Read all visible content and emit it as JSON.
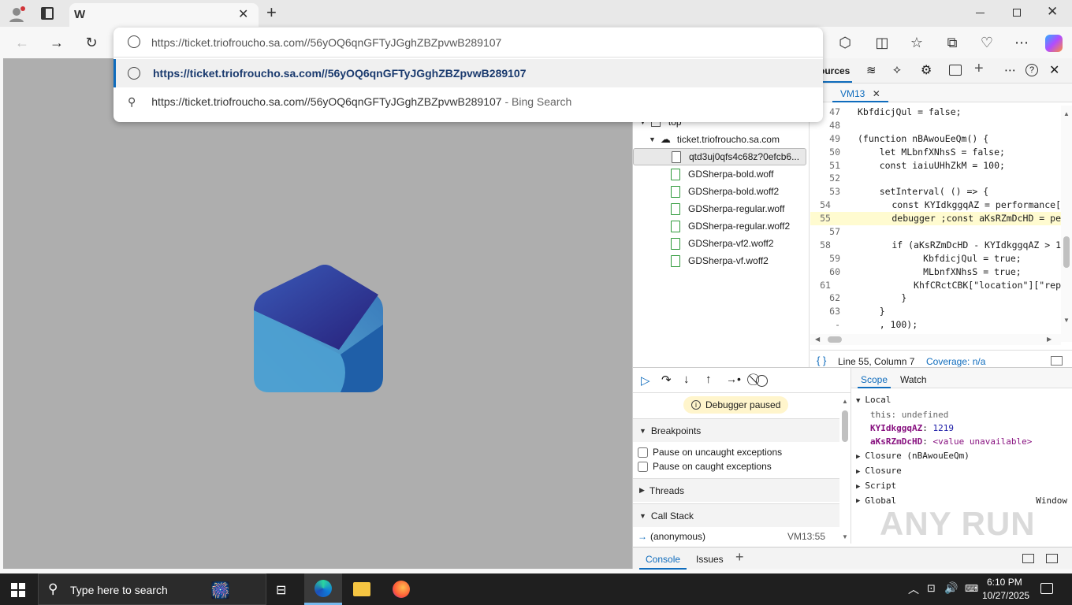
{
  "browser": {
    "tab_title_icon": "W",
    "url": "https://ticket.triofroucho.sa.com//56yOQ6qnGFTyJGghZBZpvwB289107",
    "suggestion_url": "https://ticket.triofroucho.sa.com//56yOQ6qnGFTyJGghZBZpvwB289107",
    "suggestion_search": "https://ticket.triofroucho.sa.com//56yOQ6qnGFTyJGghZBZpvwB289107",
    "suggestion_search_suffix": " - Bing Search"
  },
  "devtools": {
    "sources_tab": "ources",
    "file_tab": "VM13",
    "tree": {
      "top": "top",
      "domain": "ticket.triofroucho.sa.com",
      "files": [
        "qtd3uj0qfs4c68z?0efcb6...",
        "GDSherpa-bold.woff",
        "GDSherpa-bold.woff2",
        "GDSherpa-regular.woff",
        "GDSherpa-regular.woff2",
        "GDSherpa-vf2.woff2",
        "GDSherpa-vf.woff2"
      ]
    },
    "code_lines": [
      {
        "n": "47",
        "t": "KbfdicjQul = false;"
      },
      {
        "n": "48",
        "t": ""
      },
      {
        "n": "49",
        "t": "(function nBAwouEeQm() {"
      },
      {
        "n": "50",
        "t": "    let MLbnfXNhsS = false;"
      },
      {
        "n": "51",
        "t": "    const iaiuUHhZkM = 100;"
      },
      {
        "n": "52",
        "t": ""
      },
      {
        "n": "53",
        "t": "    setInterval( () => {"
      },
      {
        "n": "54",
        "t": "        const KYIdkggqAZ = performance["
      },
      {
        "n": "55",
        "t": "        debugger ;const aKsRZmDcHD = pe"
      },
      {
        "n": "57",
        "t": ""
      },
      {
        "n": "58",
        "t": "        if (aKsRZmDcHD - KYIdkggqAZ > 1"
      },
      {
        "n": "59",
        "t": "            KbfdicjQul = true;"
      },
      {
        "n": "60",
        "t": "            MLbnfXNhsS = true;"
      },
      {
        "n": "61",
        "t": "            KhfCRctCBK[\"location\"][\"rep"
      },
      {
        "n": "62",
        "t": "        }"
      },
      {
        "n": "63",
        "t": "    }"
      },
      {
        "n": "-",
        "t": "    , 100);"
      }
    ],
    "status_pos": "Line 55, Column 7",
    "coverage": "Coverage: n/a",
    "paused_label": "Debugger paused",
    "breakpoints_label": "Breakpoints",
    "pause_uncaught": "Pause on uncaught exceptions",
    "pause_caught": "Pause on caught exceptions",
    "threads_label": "Threads",
    "callstack_label": "Call Stack",
    "callstack_fn": "(anonymous)",
    "callstack_loc": "VM13:55",
    "scope_tab": "Scope",
    "watch_tab": "Watch",
    "scope": {
      "local": "Local",
      "this_key": "this",
      "this_val": "undefined",
      "v1_key": "KYIdkggqAZ",
      "v1_val": "1219",
      "v2_key": "aKsRZmDcHD",
      "v2_val": "<value unavailable>",
      "closure1": "Closure (nBAwouEeQm)",
      "closure2": "Closure",
      "script": "Script",
      "global": "Global",
      "global_val": "Window"
    },
    "drawer_console": "Console",
    "drawer_issues": "Issues"
  },
  "taskbar": {
    "search_placeholder": "Type here to search",
    "time": "6:10 PM",
    "date": "10/27/2025"
  },
  "watermark": "ANY RUN",
  "colors": {
    "accent": "#0f6cbd",
    "paused_bg": "#fff5cc",
    "highlight_line": "#fffbd0",
    "logo_dark": "#1f3fa8",
    "logo_light": "#4d9fd0"
  }
}
